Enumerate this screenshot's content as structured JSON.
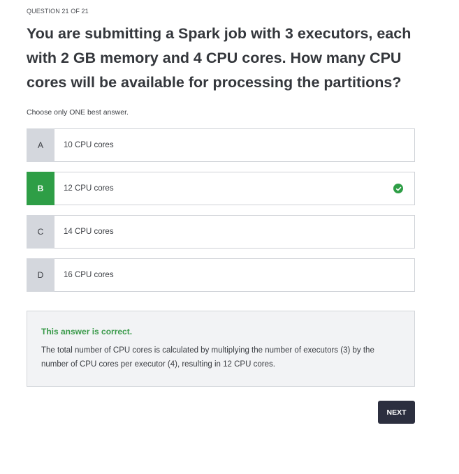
{
  "header": {
    "counter": "QUESTION 21 OF 21"
  },
  "question": {
    "text": "You are submitting a Spark job with 3 executors, each with 2 GB memory and 4 CPU cores. How many CPU cores will be available for processing the partitions?",
    "instruction": "Choose only ONE best answer."
  },
  "options": [
    {
      "letter": "A",
      "label": "10 CPU cores",
      "correct": false
    },
    {
      "letter": "B",
      "label": "12 CPU cores",
      "correct": true
    },
    {
      "letter": "C",
      "label": "14 CPU cores",
      "correct": false
    },
    {
      "letter": "D",
      "label": "16 CPU cores",
      "correct": false
    }
  ],
  "feedback": {
    "status": "This answer is correct.",
    "explanation": "The total number of CPU cores is calculated by multiplying the number of executors (3) by the number of CPU cores per executor (4), resulting in 12 CPU cores."
  },
  "actions": {
    "next_label": "NEXT"
  },
  "colors": {
    "correct": "#2e9e46",
    "letter_bg": "#d4d7dd",
    "next_bg": "#2c2f3f"
  },
  "icons": {
    "correct_indicator": "check-circle-icon"
  }
}
